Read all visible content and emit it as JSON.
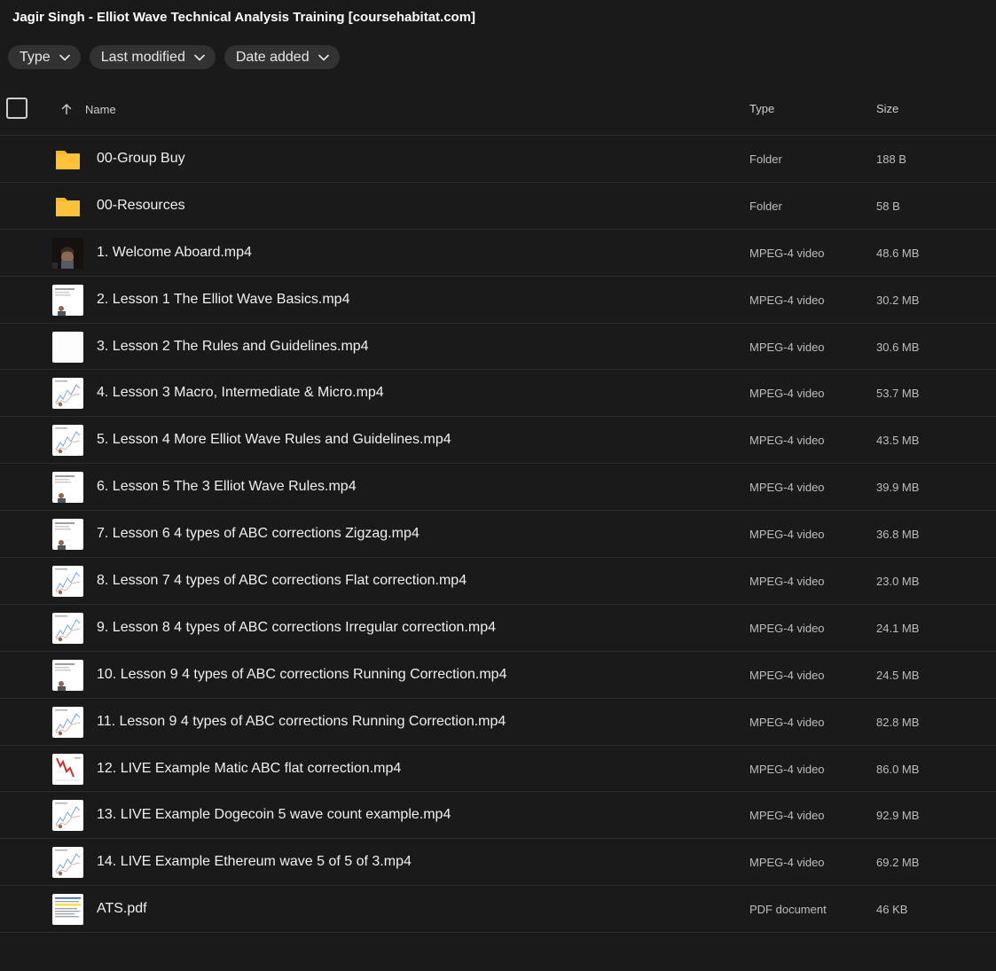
{
  "title": "Jagir Singh - Elliot Wave Technical Analysis Training [coursehabitat.com]",
  "filters": [
    {
      "label": "Type"
    },
    {
      "label": "Last modified"
    },
    {
      "label": "Date added"
    }
  ],
  "columns": {
    "name": "Name",
    "type": "Type",
    "size": "Size"
  },
  "colors": {
    "background": "#1a1a1a",
    "folder": "#f9b82a",
    "chip": "#323232",
    "divider": "#2c2c2c"
  },
  "files": [
    {
      "name": "00-Group Buy",
      "type": "Folder",
      "size": "188 B",
      "icon": "folder-icon"
    },
    {
      "name": "00-Resources",
      "type": "Folder",
      "size": "58 B",
      "icon": "folder-icon"
    },
    {
      "name": "1. Welcome Aboard.mp4",
      "type": "MPEG-4 video",
      "size": "48.6 MB",
      "icon": "video-thumbnail-presenter"
    },
    {
      "name": "2. Lesson 1 The Elliot Wave Basics.mp4",
      "type": "MPEG-4 video",
      "size": "30.2 MB",
      "icon": "video-thumbnail-slide"
    },
    {
      "name": "3. Lesson 2 The Rules and Guidelines.mp4",
      "type": "MPEG-4 video",
      "size": "30.6 MB",
      "icon": "video-thumbnail-blank"
    },
    {
      "name": "4. Lesson 3 Macro, Intermediate & Micro.mp4",
      "type": "MPEG-4 video",
      "size": "53.7 MB",
      "icon": "video-thumbnail-chart"
    },
    {
      "name": "5. Lesson 4 More Elliot Wave Rules and Guidelines.mp4",
      "type": "MPEG-4 video",
      "size": "43.5 MB",
      "icon": "video-thumbnail-chart"
    },
    {
      "name": "6. Lesson 5 The 3 Elliot Wave Rules.mp4",
      "type": "MPEG-4 video",
      "size": "39.9 MB",
      "icon": "video-thumbnail-slide"
    },
    {
      "name": "7. Lesson 6 4 types of ABC corrections Zigzag.mp4",
      "type": "MPEG-4 video",
      "size": "36.8 MB",
      "icon": "video-thumbnail-slide"
    },
    {
      "name": "8. Lesson 7 4 types of ABC corrections Flat correction.mp4",
      "type": "MPEG-4 video",
      "size": "23.0 MB",
      "icon": "video-thumbnail-chart"
    },
    {
      "name": "9. Lesson 8 4 types of ABC corrections Irregular correction.mp4",
      "type": "MPEG-4 video",
      "size": "24.1 MB",
      "icon": "video-thumbnail-chart"
    },
    {
      "name": "10. Lesson 9 4 types of ABC corrections Running Correction.mp4",
      "type": "MPEG-4 video",
      "size": "24.5 MB",
      "icon": "video-thumbnail-slide"
    },
    {
      "name": "11. Lesson 9 4 types of ABC corrections Running Correction.mp4",
      "type": "MPEG-4 video",
      "size": "82.8 MB",
      "icon": "video-thumbnail-chart"
    },
    {
      "name": "12. LIVE Example Matic ABC flat correction.mp4",
      "type": "MPEG-4 video",
      "size": "86.0 MB",
      "icon": "video-thumbnail-red-chart"
    },
    {
      "name": "13. LIVE Example Dogecoin 5 wave count example.mp4",
      "type": "MPEG-4 video",
      "size": "92.9 MB",
      "icon": "video-thumbnail-chart"
    },
    {
      "name": "14. LIVE Example Ethereum wave 5 of 5 of 3.mp4",
      "type": "MPEG-4 video",
      "size": "69.2 MB",
      "icon": "video-thumbnail-chart"
    },
    {
      "name": "ATS.pdf",
      "type": "PDF document",
      "size": "46 KB",
      "icon": "pdf-thumbnail"
    }
  ]
}
